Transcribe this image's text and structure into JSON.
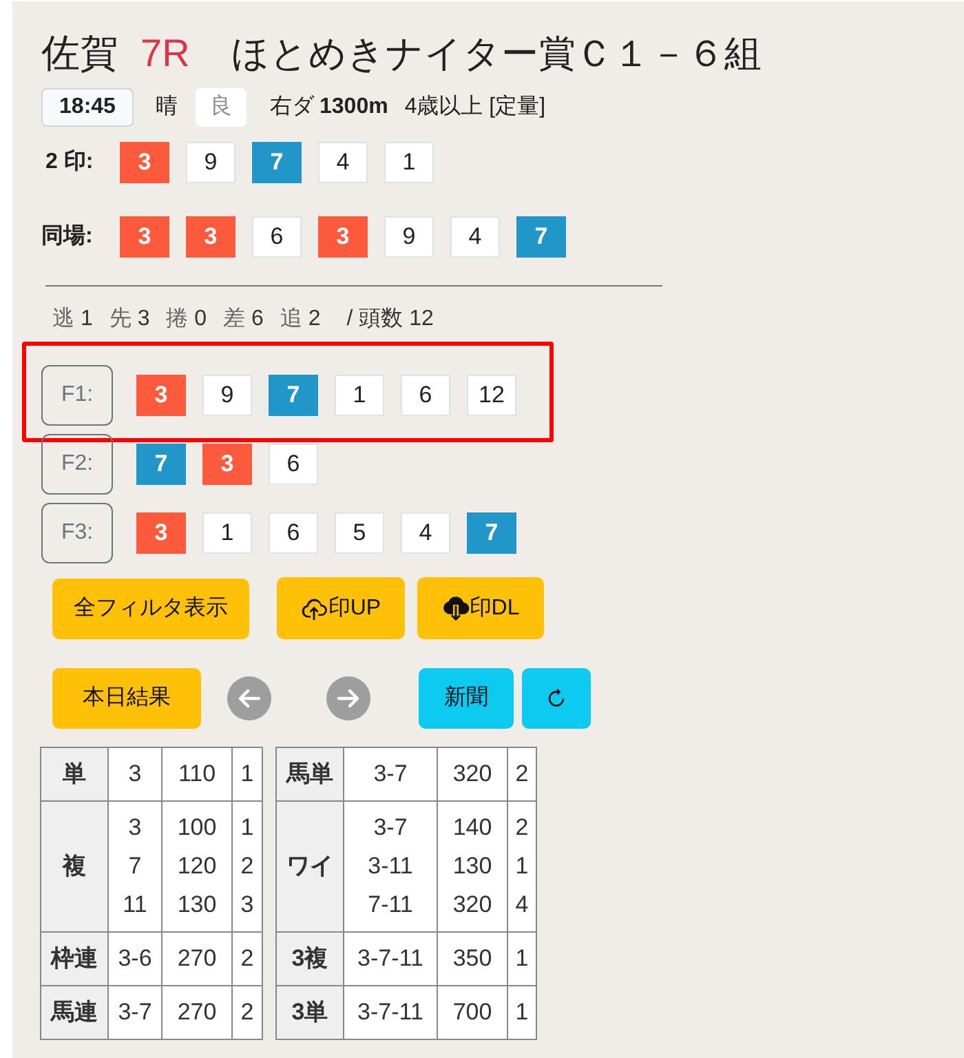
{
  "race": {
    "venue": "佐賀",
    "number": "7R",
    "name": "ほとめきナイター賞Ｃ１－６組"
  },
  "info": {
    "time": "18:45",
    "weather": "晴",
    "going": "良",
    "course": "右ダ",
    "distance": "1300m",
    "conditions": "4歳以上 [定量]"
  },
  "mark_rows": [
    {
      "label": "2 印:",
      "marks": [
        {
          "number": "3",
          "color": "#fb5b3c"
        },
        {
          "number": "9"
        },
        {
          "number": "7",
          "color": "#2197c9"
        },
        {
          "number": "4"
        },
        {
          "number": "1"
        }
      ]
    },
    {
      "label": "同場:",
      "marks": [
        {
          "number": "3",
          "color": "#fb5b3c"
        },
        {
          "number": "3",
          "color": "#fb5b3c"
        },
        {
          "number": "6"
        },
        {
          "number": "3",
          "color": "#fb5b3c"
        },
        {
          "number": "9"
        },
        {
          "number": "4"
        },
        {
          "number": "7",
          "color": "#2197c9"
        }
      ]
    }
  ],
  "running_styles": [
    {
      "label": "逃",
      "count": "1"
    },
    {
      "label": "先",
      "count": "3"
    },
    {
      "label": "捲",
      "count": "0"
    },
    {
      "label": "差",
      "count": "6"
    },
    {
      "label": "追",
      "count": "2"
    }
  ],
  "field_size": "/ 頭数 12",
  "filters": [
    {
      "label": "F1:",
      "highlighted": true,
      "marks": [
        {
          "number": "3",
          "color": "#fb5b3c"
        },
        {
          "number": "9"
        },
        {
          "number": "7",
          "color": "#2197c9"
        },
        {
          "number": "1"
        },
        {
          "number": "6"
        },
        {
          "number": "12"
        }
      ]
    },
    {
      "label": "F2:",
      "highlighted": false,
      "marks": [
        {
          "number": "7",
          "color": "#2197c9"
        },
        {
          "number": "3",
          "color": "#fb5b3c"
        },
        {
          "number": "6"
        }
      ]
    },
    {
      "label": "F3:",
      "highlighted": false,
      "marks": [
        {
          "number": "3",
          "color": "#fb5b3c"
        },
        {
          "number": "1"
        },
        {
          "number": "6"
        },
        {
          "number": "5"
        },
        {
          "number": "4"
        },
        {
          "number": "7",
          "color": "#2197c9"
        }
      ]
    }
  ],
  "actions": [
    {
      "kind": "label",
      "color": "#ffc107",
      "label": "全フィルタ表示"
    },
    {
      "kind": "upload",
      "color": "#ffc107",
      "label": "印UP"
    },
    {
      "kind": "download",
      "color": "#ffc107",
      "label": "印DL"
    }
  ],
  "nav": [
    {
      "kind": "label",
      "color": "#ffc107",
      "label": "本日結果"
    },
    {
      "kind": "prev"
    },
    {
      "kind": "next"
    },
    {
      "kind": "label",
      "color": "#0dcaf0",
      "label": "新聞"
    },
    {
      "kind": "reload",
      "color": "#0dcaf0"
    }
  ],
  "payouts": [
    {
      "rows": [
        {
          "bet": "単",
          "lines": [
            {
              "combination": "3",
              "payout": "110",
              "popularity": "1"
            }
          ]
        },
        {
          "bet": "複",
          "lines": [
            {
              "combination": "3",
              "payout": "100",
              "popularity": "1"
            },
            {
              "combination": "7",
              "payout": "120",
              "popularity": "2"
            },
            {
              "combination": "11",
              "payout": "130",
              "popularity": "3"
            }
          ]
        },
        {
          "bet": "枠連",
          "lines": [
            {
              "combination": "3-6",
              "payout": "270",
              "popularity": "2"
            }
          ]
        },
        {
          "bet": "馬連",
          "lines": [
            {
              "combination": "3-7",
              "payout": "270",
              "popularity": "2"
            }
          ]
        }
      ]
    },
    {
      "rows": [
        {
          "bet": "馬単",
          "lines": [
            {
              "combination": "3-7",
              "payout": "320",
              "popularity": "2"
            }
          ]
        },
        {
          "bet": "ワイ",
          "lines": [
            {
              "combination": "3-7",
              "payout": "140",
              "popularity": "2"
            },
            {
              "combination": "3-11",
              "payout": "130",
              "popularity": "1"
            },
            {
              "combination": "7-11",
              "payout": "320",
              "popularity": "4"
            }
          ]
        },
        {
          "bet": "3複",
          "lines": [
            {
              "combination": "3-7-11",
              "payout": "350",
              "popularity": "1"
            }
          ]
        },
        {
          "bet": "3単",
          "lines": [
            {
              "combination": "3-7-11",
              "payout": "700",
              "popularity": "1"
            }
          ]
        }
      ]
    }
  ]
}
